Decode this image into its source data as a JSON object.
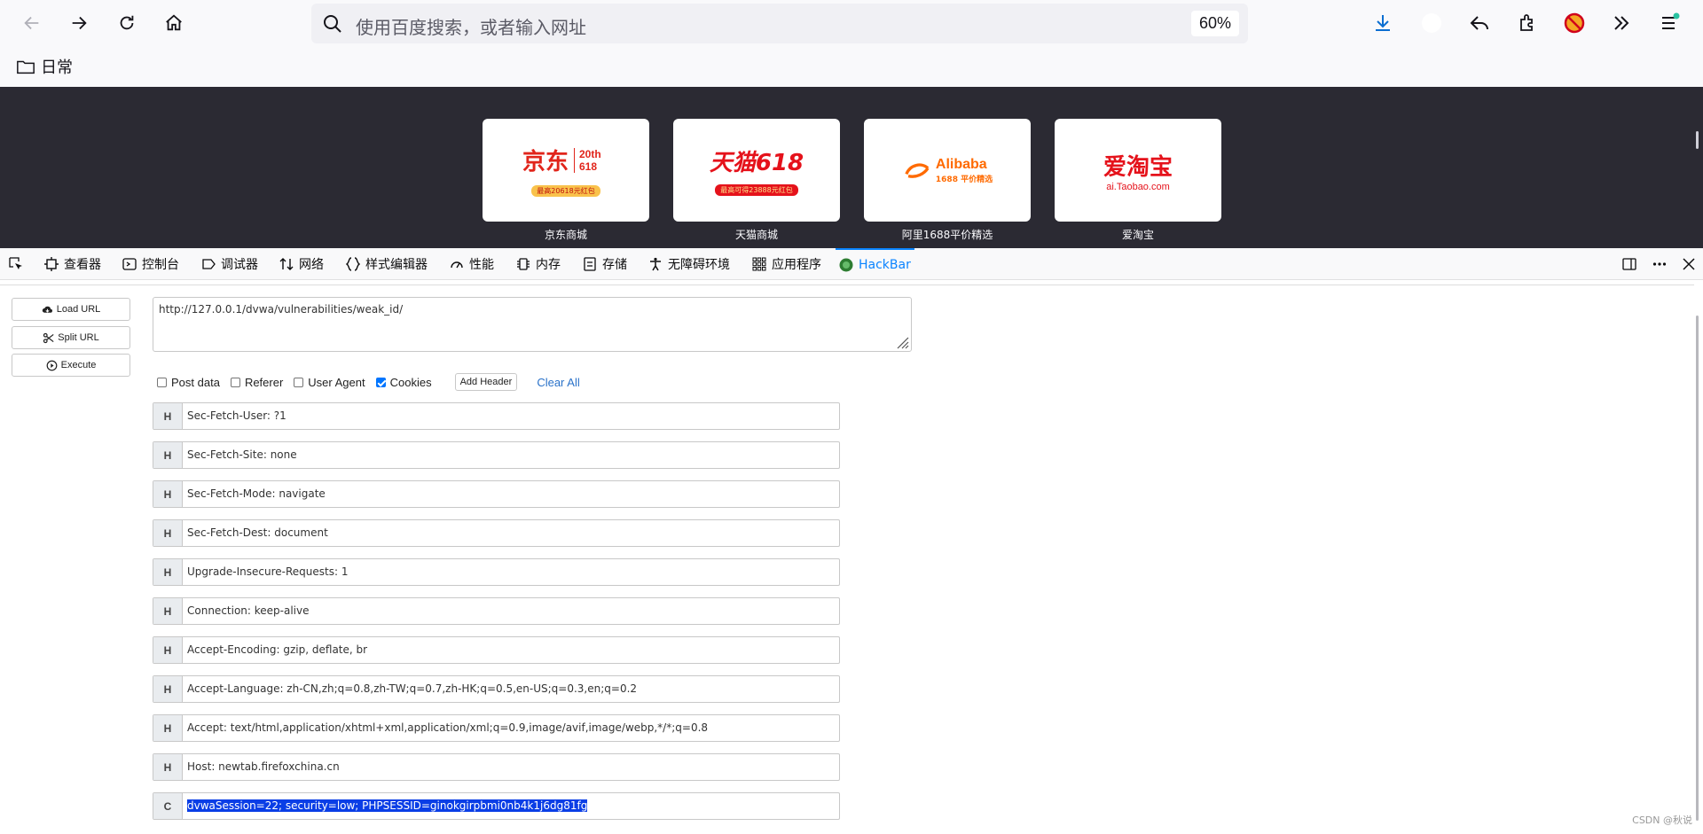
{
  "browser": {
    "search_placeholder": "使用百度搜索，或者输入网址",
    "zoom_level": "60%"
  },
  "bookmarks": {
    "folder_label": "日常"
  },
  "newtab": {
    "tiles": [
      {
        "label": "京东商城",
        "logo_text": "京东",
        "logo_sub": "20th 618",
        "logo_tag": "最高20618元红包"
      },
      {
        "label": "天猫商城",
        "logo_text": "天猫618",
        "logo_tag": "最高可得23888元红包"
      },
      {
        "label": "阿里1688平价精选",
        "logo_text": "Alibaba",
        "logo_sub": "1688 平价精选"
      },
      {
        "label": "爱淘宝",
        "logo_text": "爱淘宝",
        "logo_sub": "ai.Taobao.com"
      }
    ]
  },
  "devtools": {
    "tabs": [
      {
        "label": "查看器"
      },
      {
        "label": "控制台"
      },
      {
        "label": "调试器"
      },
      {
        "label": "网络"
      },
      {
        "label": "样式编辑器"
      },
      {
        "label": "性能"
      },
      {
        "label": "内存"
      },
      {
        "label": "存储"
      },
      {
        "label": "无障碍环境"
      },
      {
        "label": "应用程序"
      },
      {
        "label": "HackBar"
      }
    ]
  },
  "hackbar": {
    "buttons": {
      "load_url": "Load URL",
      "split_url": "Split URL",
      "execute": "Execute"
    },
    "url": "http://127.0.0.1/dvwa/vulnerabilities/weak_id/",
    "options": {
      "post_data": "Post data",
      "referer": "Referer",
      "user_agent": "User Agent",
      "cookies": "Cookies",
      "add_header": "Add Header",
      "clear_all": "Clear All"
    },
    "headers": [
      {
        "tag": "H",
        "value": "Sec-Fetch-User: ?1"
      },
      {
        "tag": "H",
        "value": "Sec-Fetch-Site: none"
      },
      {
        "tag": "H",
        "value": "Sec-Fetch-Mode: navigate"
      },
      {
        "tag": "H",
        "value": "Sec-Fetch-Dest: document"
      },
      {
        "tag": "H",
        "value": "Upgrade-Insecure-Requests: 1"
      },
      {
        "tag": "H",
        "value": "Connection: keep-alive"
      },
      {
        "tag": "H",
        "value": "Accept-Encoding: gzip, deflate, br"
      },
      {
        "tag": "H",
        "value": "Accept-Language: zh-CN,zh;q=0.8,zh-TW;q=0.7,zh-HK;q=0.5,en-US;q=0.3,en;q=0.2"
      },
      {
        "tag": "H",
        "value": "Accept: text/html,application/xhtml+xml,application/xml;q=0.9,image/avif,image/webp,*/*;q=0.8"
      },
      {
        "tag": "H",
        "value": "Host: newtab.firefoxchina.cn"
      },
      {
        "tag": "C",
        "value": "dvwaSession=22; security=low; PHPSESSID=ginokgirpbmi0nb4k1j6dg81fg"
      }
    ]
  },
  "watermark": "CSDN @秋说"
}
